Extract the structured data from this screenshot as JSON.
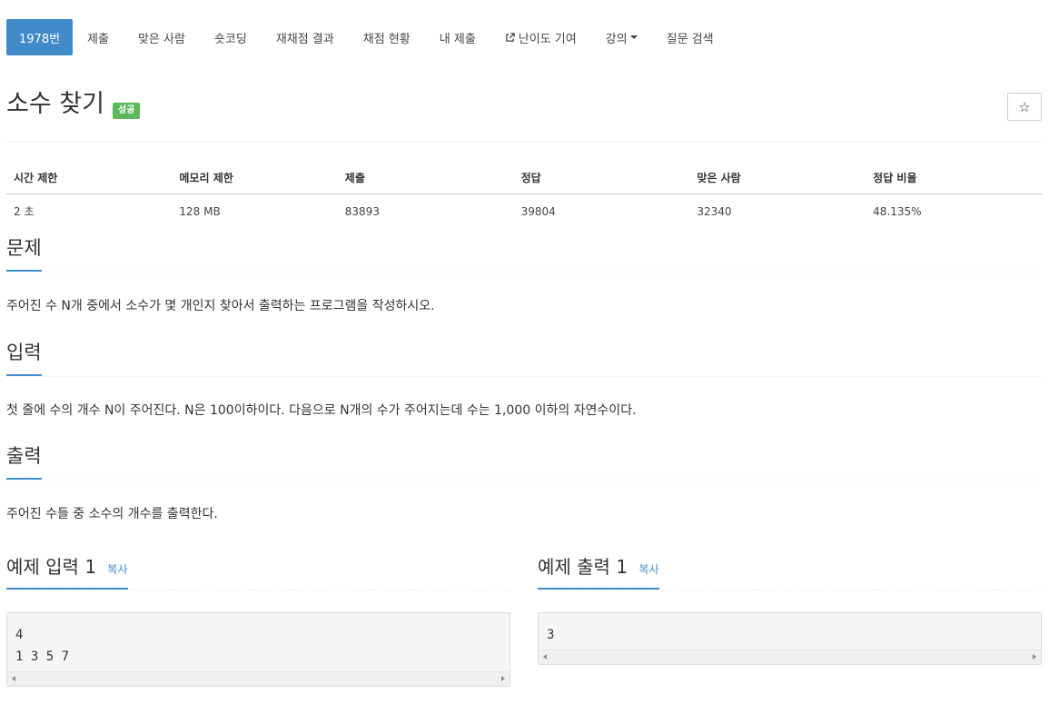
{
  "nav": {
    "items": [
      {
        "label": "1978번",
        "active": true
      },
      {
        "label": "제출"
      },
      {
        "label": "맞은 사람"
      },
      {
        "label": "숏코딩"
      },
      {
        "label": "재채점 결과"
      },
      {
        "label": "채점 현황"
      },
      {
        "label": "내 제출"
      },
      {
        "label": "난이도 기여",
        "icon": "external-link-icon"
      },
      {
        "label": "강의",
        "icon": "caret-down-icon"
      },
      {
        "label": "질문 검색"
      }
    ]
  },
  "problem": {
    "title": "소수 찾기",
    "status_badge": "성공",
    "star_icon": "☆"
  },
  "info": {
    "headers": [
      "시간 제한",
      "메모리 제한",
      "제출",
      "정답",
      "맞은 사람",
      "정답 비율"
    ],
    "values": [
      "2 초",
      "128 MB",
      "83893",
      "39804",
      "32340",
      "48.135%"
    ]
  },
  "sections": {
    "description": {
      "heading": "문제",
      "body": "주어진 수 N개 중에서 소수가 몇 개인지 찾아서 출력하는 프로그램을 작성하시오."
    },
    "input": {
      "heading": "입력",
      "body": "첫 줄에 수의 개수 N이 주어진다. N은 100이하이다. 다음으로 N개의 수가 주어지는데 수는 1,000 이하의 자연수이다."
    },
    "output": {
      "heading": "출력",
      "body": "주어진 수들 중 소수의 개수를 출력한다."
    }
  },
  "samples": {
    "input": {
      "heading": "예제 입력 1",
      "copy_label": "복사",
      "content": "4\n1 3 5 7"
    },
    "output": {
      "heading": "예제 출력 1",
      "copy_label": "복사",
      "content": "3"
    }
  },
  "colors": {
    "primary": "#428bca",
    "success": "#5cb85c"
  }
}
